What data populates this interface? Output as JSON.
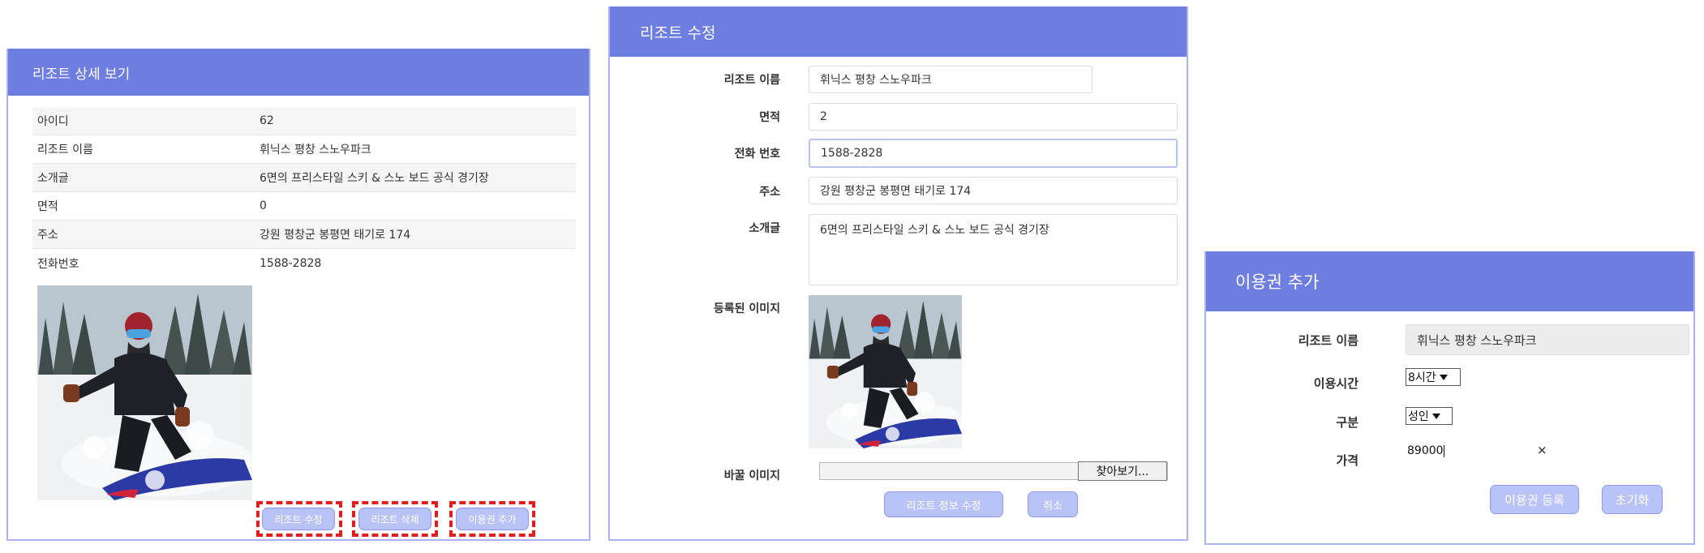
{
  "detail": {
    "title": "리조트 상세 보기",
    "rows": [
      {
        "label": "아이디",
        "value": "62"
      },
      {
        "label": "리조트 이름",
        "value": "휘닉스 평창 스노우파크"
      },
      {
        "label": "소개글",
        "value": "6면의 프리스타일 스키 & 스노 보드 공식 경기장"
      },
      {
        "label": "면적",
        "value": "0"
      },
      {
        "label": "주소",
        "value": "강원 평창군 봉평면 태기로 174"
      },
      {
        "label": "전화번호",
        "value": "1588-2828"
      }
    ],
    "buttons": {
      "edit": "리조트 수정",
      "delete": "리조트 삭제",
      "add_voucher": "이용권 추가"
    }
  },
  "edit": {
    "title": "리조트 수정",
    "labels": {
      "name": "리조트 이름",
      "area": "면적",
      "phone": "전화 번호",
      "address": "주소",
      "intro": "소개글",
      "registered_image": "등록된 이미지",
      "replace_image": "바꿀 이미지"
    },
    "values": {
      "name": "휘닉스 평창 스노우파크",
      "area": "2",
      "phone": "1588-2828",
      "address": "강원 평창군 봉평면 태기로 174",
      "intro": "6면의 프리스타일 스키 & 스노 보드 공식 경기장"
    },
    "browse_button": "찾아보기...",
    "buttons": {
      "submit": "리조트 정보 수정",
      "cancel": "취소"
    }
  },
  "voucher": {
    "title": "이용권 추가",
    "labels": {
      "name": "리조트 이름",
      "time": "이용시간",
      "type": "구분",
      "price": "가격"
    },
    "name_value": "휘닉스 평창 스노우파크",
    "time_selected": "8시간",
    "type_selected": "성인",
    "price_value": "89000",
    "clear_glyph": "×",
    "buttons": {
      "register": "이용권 등록",
      "reset": "초기화"
    }
  },
  "colors": {
    "header": "#6e7de0",
    "button": "#b9c3f7",
    "highlight_dash": "#e02020"
  }
}
